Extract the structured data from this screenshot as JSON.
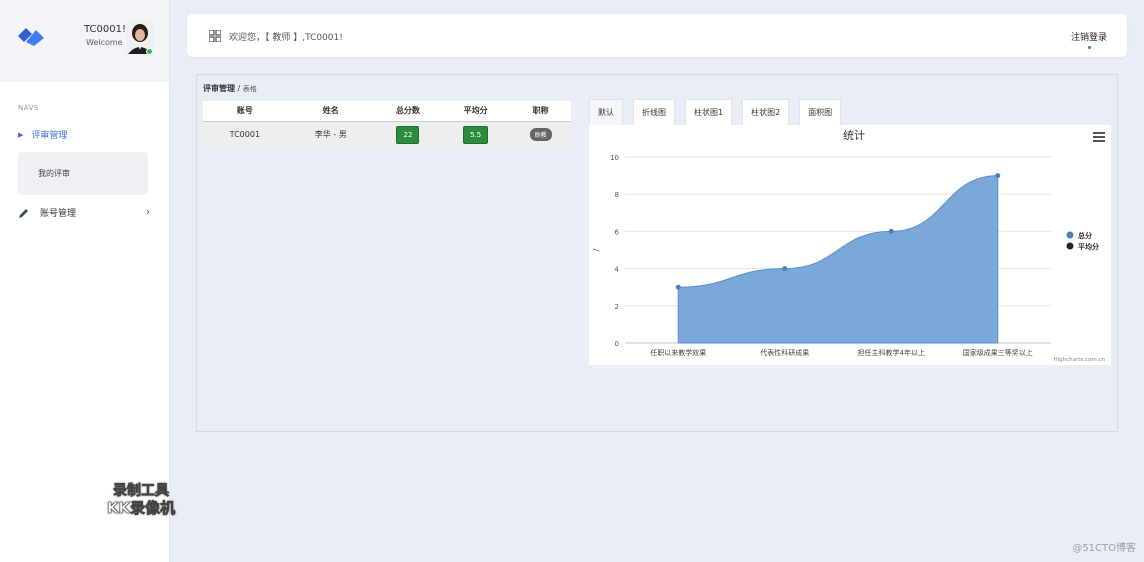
{
  "sidebar": {
    "user_name": "TC0001!",
    "user_sub": "Welcome",
    "navs_title": "NAVS",
    "items": [
      {
        "label": "评审管理",
        "icon": "caret-right-icon",
        "active": true
      },
      {
        "label": "账号管理",
        "icon": "pencil-icon"
      }
    ],
    "sub_items": [
      {
        "label": "我的评审"
      }
    ]
  },
  "watermark": {
    "line1": "录制工具",
    "line2": "KK录像机"
  },
  "topbar": {
    "welcome": "欢迎您，【 教师 】,TC0001!",
    "logout": "注销登录"
  },
  "breadcrumb": {
    "section": "评审管理",
    "separator": " / ",
    "page": "表格"
  },
  "table": {
    "headers": [
      "账号",
      "姓名",
      "总分数",
      "平均分",
      "职称"
    ],
    "rows": [
      {
        "account": "TC0001",
        "name": "李华 - 男",
        "total": "22",
        "avg": "5.5",
        "title": "助教"
      }
    ]
  },
  "chart_tabs": [
    "默认",
    "折线图",
    "柱状图1",
    "柱状图2",
    "面积图"
  ],
  "chart_data": {
    "type": "area",
    "title": "统计",
    "categories": [
      "任职以来教学效果",
      "代表性科研成果",
      "担任主科教学4年以上",
      "国家级成果三等奖以上"
    ],
    "series": [
      {
        "name": "总分",
        "values": [
          3,
          4,
          6,
          9
        ],
        "color": "#7aa8d8"
      },
      {
        "name": "平均分",
        "values": [],
        "color": "#222222"
      }
    ],
    "ylabel": "/",
    "ylim": [
      0,
      10
    ],
    "yticks": [
      0,
      2,
      4,
      6,
      8,
      10
    ],
    "grid": true,
    "legend": "right",
    "credits": "Highcharts.com.cn"
  },
  "corner_watermark": "@51CTO博客"
}
